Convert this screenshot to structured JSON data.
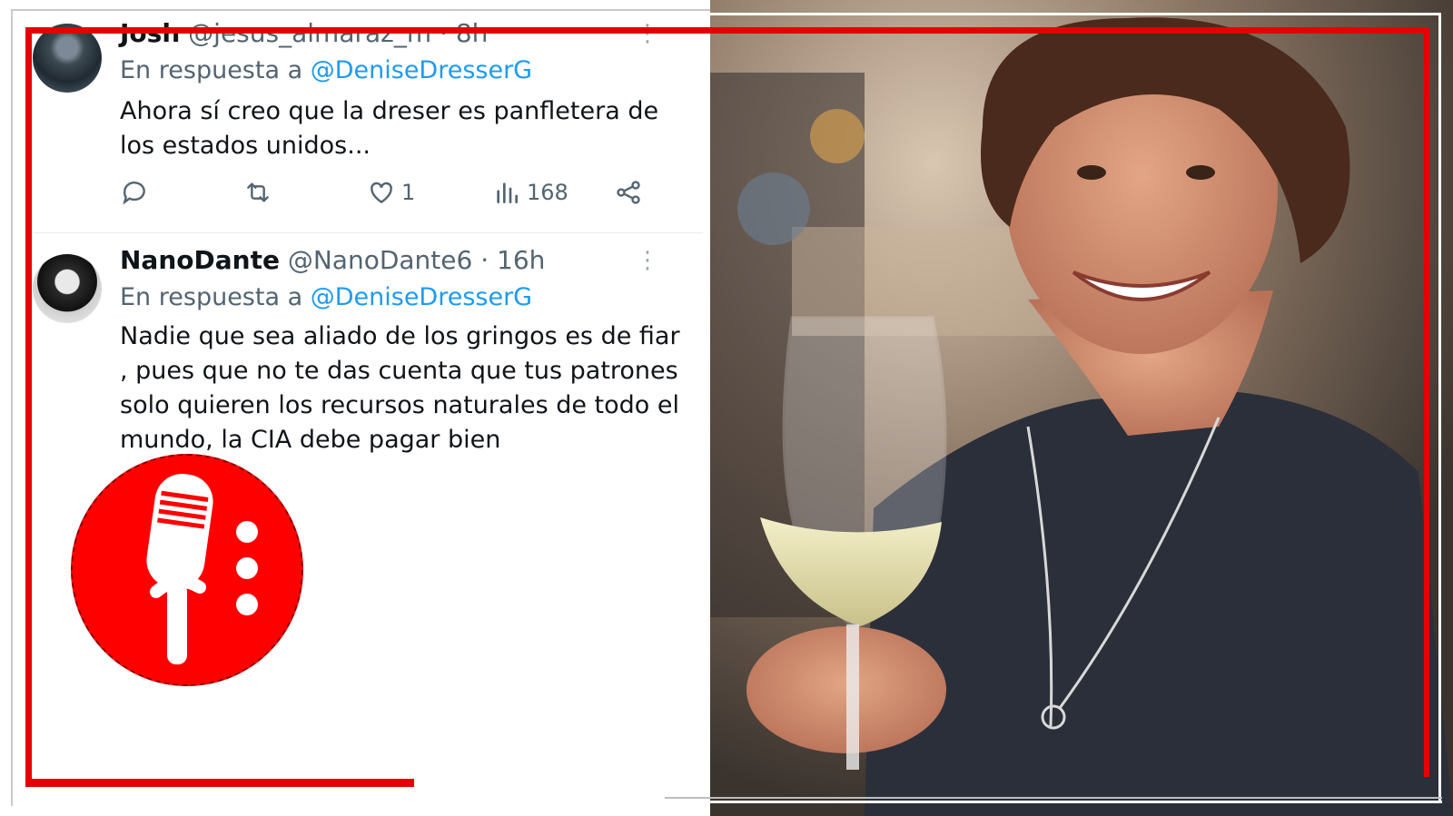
{
  "tweets": [
    {
      "name": "Josh",
      "handle": "@jesus_almaraz_m",
      "time": "· 8h",
      "reply_prefix": "En respuesta a",
      "reply_to": "@DeniseDresserG",
      "text": "Ahora sí creo que la dreser es panfletera de los estados unidos...",
      "likes": "1",
      "views": "168"
    },
    {
      "name": "NanoDante",
      "handle": "@NanoDante6",
      "time": "· 16h",
      "reply_prefix": "En respuesta a",
      "reply_to": "@DeniseDresserG",
      "text": "Nadie que sea aliado de los gringos es de fiar , pues que no te das cuenta que tus patrones solo quieren los recursos naturales de todo el mundo,  la CIA debe pagar bien"
    }
  ],
  "icons": {
    "reply": "reply-icon",
    "retweet": "retweet-icon",
    "like": "heart-icon",
    "views": "views-icon",
    "share": "share-icon",
    "more": "more-dots-icon",
    "logo": "microphone-logo"
  },
  "colors": {
    "accent": "#1d9bf0",
    "frame_red": "#e60000",
    "logo_red": "#ff0000",
    "muted_text": "#536471"
  }
}
